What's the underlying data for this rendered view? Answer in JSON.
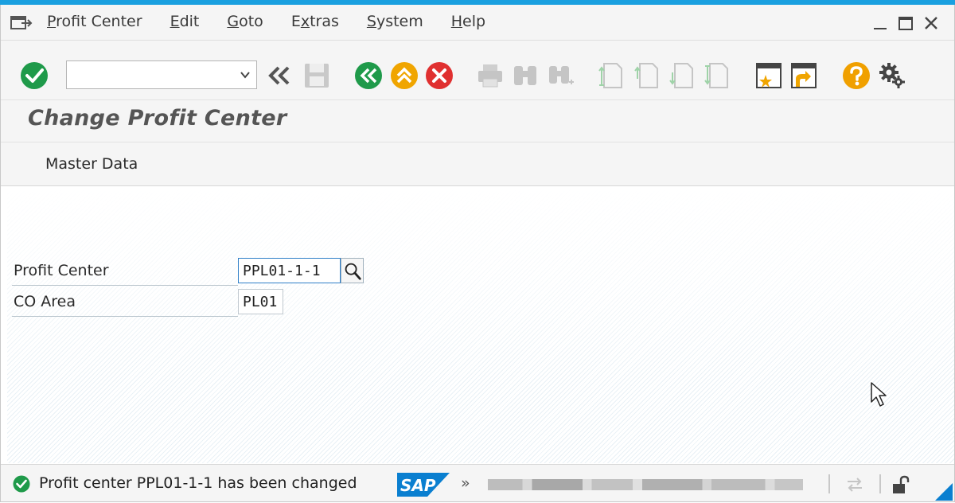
{
  "menubar": {
    "items": [
      {
        "pre": "",
        "u": "P",
        "post": "rofit Center"
      },
      {
        "pre": "",
        "u": "E",
        "post": "dit"
      },
      {
        "pre": "",
        "u": "G",
        "post": "oto"
      },
      {
        "pre": "E",
        "u": "x",
        "post": "tras"
      },
      {
        "pre": "",
        "u": "S",
        "post": "ystem"
      },
      {
        "pre": "",
        "u": "H",
        "post": "elp"
      }
    ]
  },
  "toolbar": {
    "command_field_value": ""
  },
  "title": "Change Profit Center",
  "app_toolbar": {
    "master_data_label": "Master Data"
  },
  "form": {
    "profit_center_label": "Profit Center",
    "profit_center_value": "PPL01-1-1",
    "co_area_label": "CO Area",
    "co_area_value": "PL01"
  },
  "status": {
    "message": "Profit center PPL01-1-1 has been changed",
    "type": "success",
    "sap_logo_text": "SAP",
    "chevron": "»"
  },
  "colors": {
    "accent_blue": "#1aa0e0",
    "ok_green": "#1f9a4a",
    "exit_orange": "#f0a500",
    "cancel_red": "#e03030",
    "help_orange": "#f0a000",
    "sap_blue": "#0a7fd0"
  }
}
